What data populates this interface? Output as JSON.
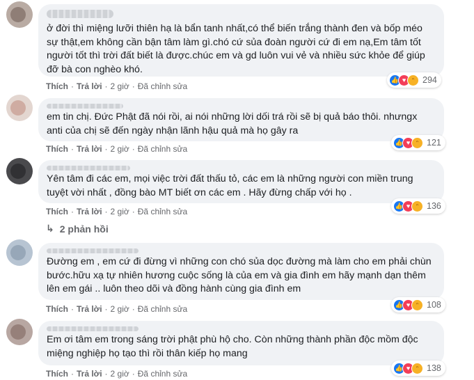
{
  "comments": [
    {
      "text": "ở đời thì miệng lưỡi thiên hạ là bẩn tanh nhất,có thể biến trắng thành đen và bốp méo sự thật,em không cần bận tâm làm gì.chó cứ sủa đoàn người cứ đi em nạ,Em tâm tốt người tốt thì trời đất biết là được.chúc em và gd luôn vui vẻ và nhiều sức khỏe để giúp đỡ bà con nghèo khó.",
      "like": "Thích",
      "reply": "Trả lời",
      "time": "2 giờ",
      "edited": "Đã chỉnh sửa",
      "reaction_count": "294"
    },
    {
      "text": "em tin chị. Đức Phật đã nói rồi, ai nói những lời dối trá rồi sẽ bị quả báo thôi. nhưngx anti của chị sẽ đến ngày nhận lãnh hậu quả mà họ gây ra",
      "like": "Thích",
      "reply": "Trả lời",
      "time": "2 giờ",
      "edited": "Đã chỉnh sửa",
      "reaction_count": "121"
    },
    {
      "text": "Yên tâm đi các em, mọi việc trời đất thấu tỏ, các em là những người con miền trung tuyệt vời nhất , đồng bào MT biết ơn các em . Hãy đừng chấp với họ .",
      "like": "Thích",
      "reply": "Trả lời",
      "time": "2 giờ",
      "edited": "Đã chỉnh sửa",
      "reaction_count": "136"
    },
    {
      "text": "Đường em , em cứ đi đừng vì những con chó sủa dọc đường mà làm cho em phải chùn bước.hữu xạ tự nhiên hương cuộc sống là của em và gia đình em hãy mạnh dạn thêm lên em gái .. luôn theo dõi và đồng hành cùng gia đình em",
      "like": "Thích",
      "reply": "Trả lời",
      "time": "2 giờ",
      "edited": "Đã chỉnh sửa",
      "reaction_count": "108"
    },
    {
      "text": "Em ơi tâm em trong sáng trời phật phù hộ cho. Còn những thành phần độc mồm độc miệng nghiệp họ tạo thì rồi thân kiếp họ mang",
      "like": "Thích",
      "reply": "Trả lời",
      "time": "2 giờ",
      "edited": "Đã chỉnh sửa",
      "reaction_count": "138"
    }
  ],
  "replies_toggle": "2 phản hồi",
  "colors": {
    "like": "#1877f2",
    "love": "#f33e58",
    "haha": "#f7b125",
    "bubble": "#f0f2f5"
  },
  "icons": [
    "like-icon",
    "love-icon",
    "haha-icon",
    "reply-arrow-icon"
  ]
}
